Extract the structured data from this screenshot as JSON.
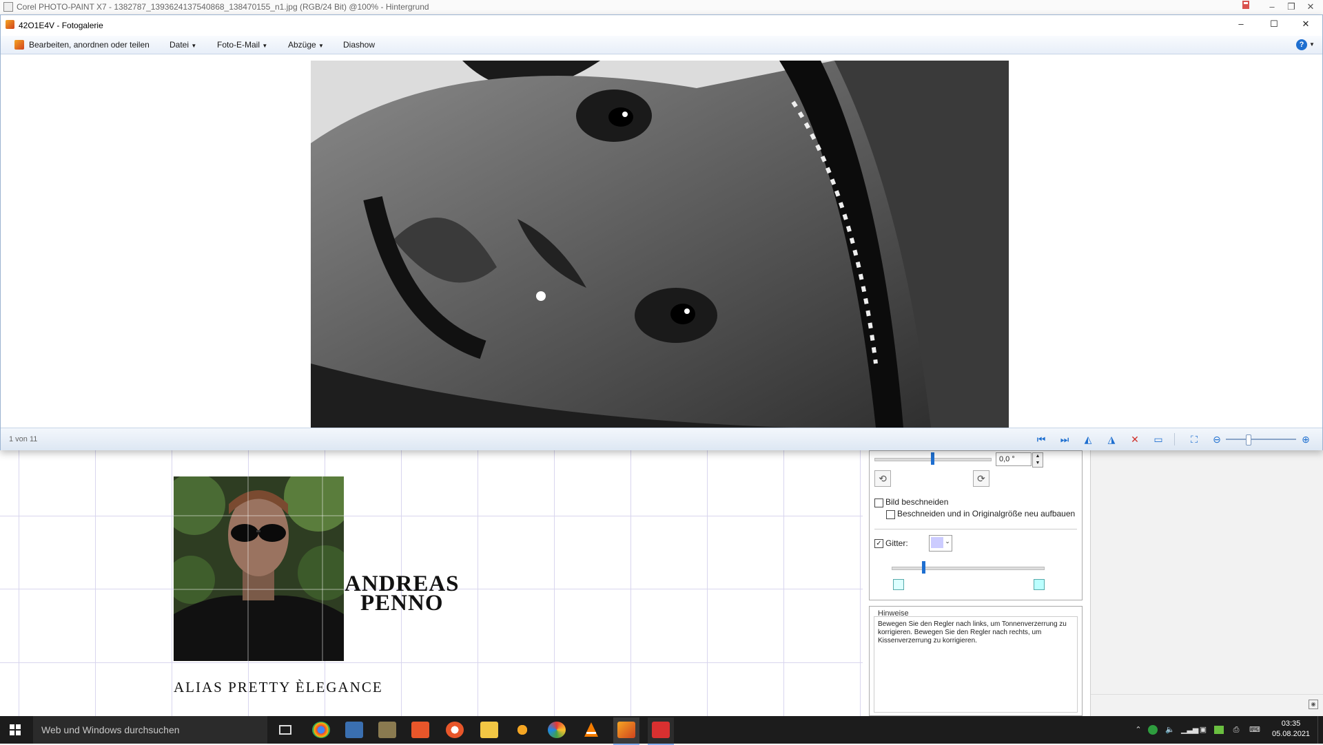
{
  "corel": {
    "title": "Corel PHOTO-PAINT X7 - 1382787_1393624137540868_138470155_n1.jpg (RGB/24 Bit) @100% - Hintergrund"
  },
  "gallery": {
    "title": "42O1E4V - Fotogalerie",
    "menu": {
      "edit": "Bearbeiten, anordnen oder teilen",
      "file": "Datei",
      "email": "Foto-E-Mail",
      "prints": "Abzüge",
      "slideshow": "Diashow"
    },
    "counter": "1 von 11"
  },
  "canvas": {
    "name_line1": "ANDREAS",
    "name_line2": "PENNO",
    "alias": "ALIAS PRETTY ÈLEGANCE"
  },
  "lens_panel": {
    "angle_value": "0,0 °",
    "crop_label": "Bild beschneiden",
    "crop_restore_label": "Beschneiden und in Originalgröße neu aufbauen",
    "grid_label": "Gitter:",
    "grid_color": "#ccccff",
    "rotation_slider_level": 0.49,
    "grid_slider_level": 0.2
  },
  "hints": {
    "title": "Hinweise",
    "text": "Bewegen Sie den Regler nach links, um Tonnenverzerrung zu korrigieren. Bewegen Sie den Regler nach rechts, um Kissenverzerrung zu korrigieren."
  },
  "taskbar": {
    "search_placeholder": "Web und Windows durchsuchen",
    "time": "03:35",
    "date": "05.08.2021"
  }
}
